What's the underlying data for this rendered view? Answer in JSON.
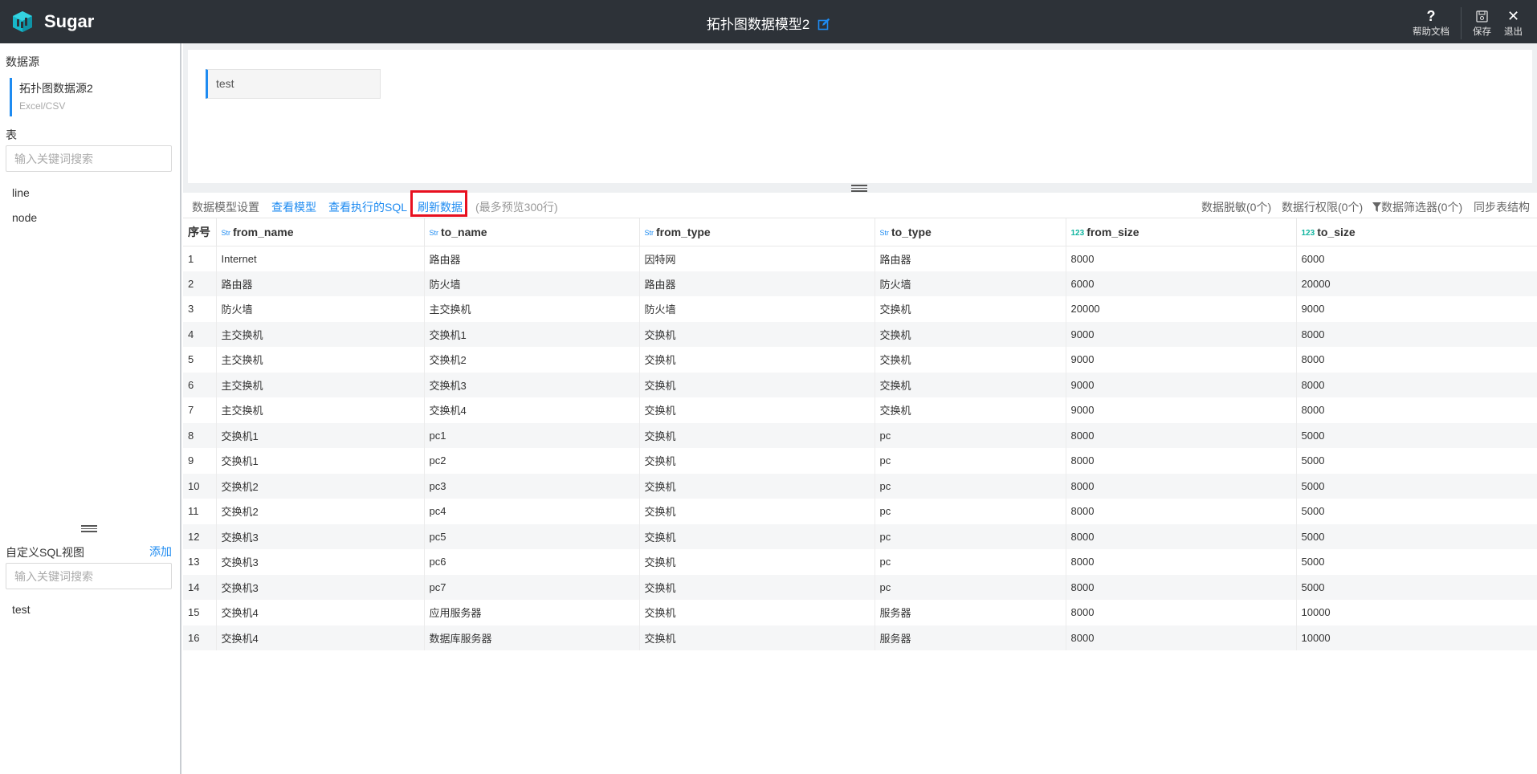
{
  "app": {
    "name": "Sugar",
    "doc_title": "拓扑图数据模型2"
  },
  "top_actions": [
    {
      "label": "帮助文档",
      "icon": "question-icon"
    },
    {
      "label": "保存",
      "icon": "save-icon"
    },
    {
      "label": "退出",
      "icon": "close-icon"
    }
  ],
  "sidebar": {
    "datasource_title": "数据源",
    "datasource": {
      "name": "拓扑图数据源2",
      "type": "Excel/CSV"
    },
    "tables_title": "表",
    "tables_search_placeholder": "输入关键词搜索",
    "tables": [
      "line",
      "node"
    ],
    "sql_views_title": "自定义SQL视图",
    "sql_views_add": "添加",
    "sql_views_search_placeholder": "输入关键词搜索",
    "sql_views": [
      "test"
    ]
  },
  "sql_editor": {
    "active_tab": "test"
  },
  "toolbar": {
    "settings": "数据模型设置",
    "view_model": "查看模型",
    "view_sql": "查看执行的SQL",
    "refresh": "刷新数据",
    "preview_note": "(最多预览300行)",
    "masking": "数据脱敏(0个)",
    "row_permission": "数据行权限(0个)",
    "filter": "数据筛选器(0个)",
    "sync": "同步表结构"
  },
  "table": {
    "index_header": "序号",
    "columns": [
      {
        "name": "from_name",
        "type": "Str"
      },
      {
        "name": "to_name",
        "type": "Str"
      },
      {
        "name": "from_type",
        "type": "Str"
      },
      {
        "name": "to_type",
        "type": "Str"
      },
      {
        "name": "from_size",
        "type": "123"
      },
      {
        "name": "to_size",
        "type": "123"
      }
    ],
    "rows": [
      [
        "1",
        "Internet",
        "路由器",
        "因特网",
        "路由器",
        "8000",
        "6000"
      ],
      [
        "2",
        "路由器",
        "防火墙",
        "路由器",
        "防火墙",
        "6000",
        "20000"
      ],
      [
        "3",
        "防火墙",
        "主交换机",
        "防火墙",
        "交换机",
        "20000",
        "9000"
      ],
      [
        "4",
        "主交换机",
        "交换机1",
        "交换机",
        "交换机",
        "9000",
        "8000"
      ],
      [
        "5",
        "主交换机",
        "交换机2",
        "交换机",
        "交换机",
        "9000",
        "8000"
      ],
      [
        "6",
        "主交换机",
        "交换机3",
        "交换机",
        "交换机",
        "9000",
        "8000"
      ],
      [
        "7",
        "主交换机",
        "交换机4",
        "交换机",
        "交换机",
        "9000",
        "8000"
      ],
      [
        "8",
        "交换机1",
        "pc1",
        "交换机",
        "pc",
        "8000",
        "5000"
      ],
      [
        "9",
        "交换机1",
        "pc2",
        "交换机",
        "pc",
        "8000",
        "5000"
      ],
      [
        "10",
        "交换机2",
        "pc3",
        "交换机",
        "pc",
        "8000",
        "5000"
      ],
      [
        "11",
        "交换机2",
        "pc4",
        "交换机",
        "pc",
        "8000",
        "5000"
      ],
      [
        "12",
        "交换机3",
        "pc5",
        "交换机",
        "pc",
        "8000",
        "5000"
      ],
      [
        "13",
        "交换机3",
        "pc6",
        "交换机",
        "pc",
        "8000",
        "5000"
      ],
      [
        "14",
        "交换机3",
        "pc7",
        "交换机",
        "pc",
        "8000",
        "5000"
      ],
      [
        "15",
        "交换机4",
        "应用服务器",
        "交换机",
        "服务器",
        "8000",
        "10000"
      ],
      [
        "16",
        "交换机4",
        "数据库服务器",
        "交换机",
        "服务器",
        "8000",
        "10000"
      ]
    ]
  },
  "colors": {
    "topbar": "#2d3238",
    "accent": "#1e8bf1",
    "highlight": "#e8101f",
    "numeric_type": "#12b5a0"
  }
}
